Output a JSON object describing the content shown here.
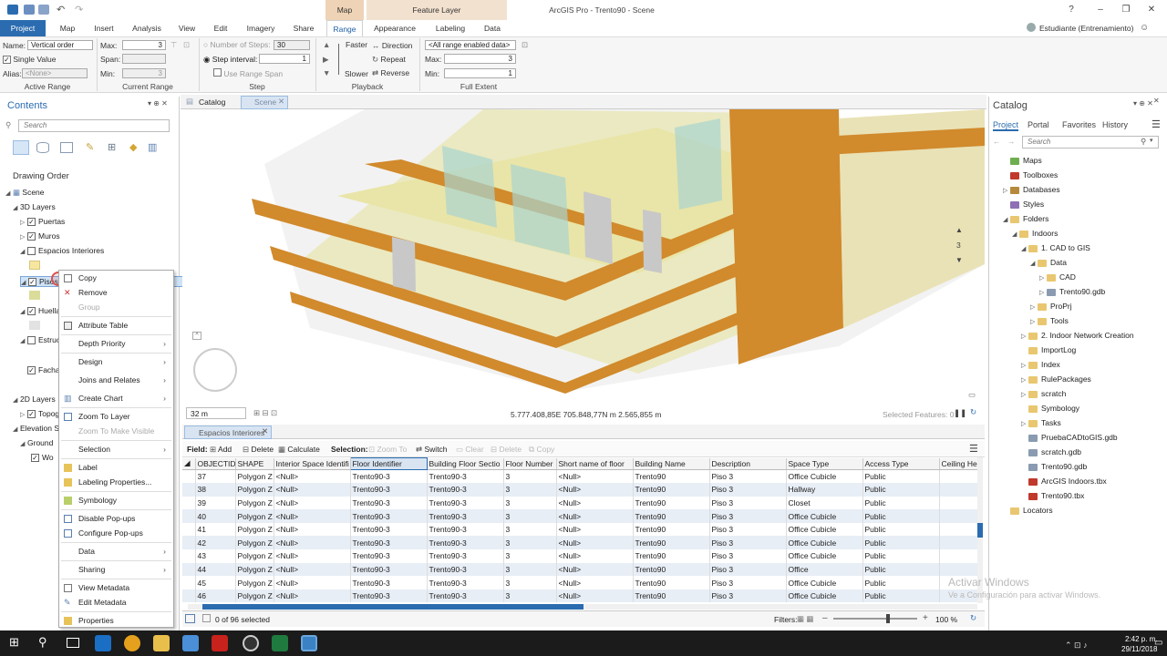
{
  "window": {
    "title": "ArcGIS Pro - Trento90 - Scene",
    "context_map": "Map",
    "context_feature_layer": "Feature Layer",
    "user": "Estudiante (Entrenamiento)",
    "help": "?"
  },
  "ribbon_tabs": [
    "Project",
    "Map",
    "Insert",
    "Analysis",
    "View",
    "Edit",
    "Imagery",
    "Share",
    "Range",
    "Appearance",
    "Labeling",
    "Data"
  ],
  "ribbon": {
    "name_label": "Name:",
    "name_value": "Vertical order",
    "single_value": "Single Value",
    "alias_label": "Alias:",
    "alias_value": "<None>",
    "max_label": "Max:",
    "max_value": "3",
    "span_label": "Span:",
    "min_label": "Min:",
    "min_value": "3",
    "num_steps": "Number of Steps:",
    "num_steps_value": "30",
    "step_interval": "Step interval:",
    "step_interval_value": "1",
    "use_range_span": "Use Range Span",
    "faster": "Faster",
    "slower": "Slower",
    "direction": "Direction",
    "repeat": "Repeat",
    "reverse": "Reverse",
    "extent_select": "<All range enabled data>",
    "ext_max_label": "Max:",
    "ext_max_value": "3",
    "ext_min_label": "Min:",
    "ext_min_value": "1",
    "groups": [
      "Active Range",
      "Current Range",
      "Step",
      "Playback",
      "Full Extent"
    ]
  },
  "contents": {
    "title": "Contents",
    "search_placeholder": "Search",
    "drawing_order": "Drawing Order",
    "tree": [
      "Scene",
      "3D Layers",
      "Puertas",
      "Muros",
      "Espacios Interiores",
      "Pisos",
      "Huella",
      "Estruct",
      "Fachas",
      "2D Layers",
      "Topog",
      "Elevation Su",
      "Ground",
      "Wo"
    ]
  },
  "context_menu": [
    "Copy",
    "Remove",
    "Group",
    "Attribute Table",
    "Depth Priority",
    "Design",
    "Joins and Relates",
    "Create Chart",
    "Zoom To Layer",
    "Zoom To Make Visible",
    "Selection",
    "Label",
    "Labeling Properties...",
    "Symbology",
    "Disable Pop-ups",
    "Configure Pop-ups",
    "Data",
    "Sharing",
    "View Metadata",
    "Edit Metadata",
    "Properties"
  ],
  "view_tabs": [
    "Catalog",
    "Scene"
  ],
  "scene": {
    "scale": "32 m",
    "coords": "5.777.408,85E 705.848,77N m   2.565,855 m",
    "selected_features": "Selected Features: 0",
    "range_value": "3"
  },
  "table": {
    "tab": "Espacios Interiores",
    "field_label": "Field:",
    "add": "Add",
    "delete": "Delete",
    "calculate": "Calculate",
    "selection_label": "Selection:",
    "zoom_to": "Zoom To",
    "switch": "Switch",
    "clear": "Clear",
    "sel_delete": "Delete",
    "copy": "Copy",
    "columns": [
      "OBJECTID",
      "SHAPE",
      "Interior Space Identifi",
      "Floor Identifier",
      "Building Floor Sectio",
      "Floor Number",
      "Short name of floor",
      "Building Name",
      "Description",
      "Space Type",
      "Access Type",
      "Ceiling He"
    ],
    "rows": [
      [
        "37",
        "Polygon Z",
        "<Null>",
        "Trento90-3",
        "Trento90-3",
        "3",
        "<Null>",
        "Trento90",
        "Piso 3",
        "Office Cubicle",
        "Public",
        ""
      ],
      [
        "38",
        "Polygon Z",
        "<Null>",
        "Trento90-3",
        "Trento90-3",
        "3",
        "<Null>",
        "Trento90",
        "Piso 3",
        "Hallway",
        "Public",
        ""
      ],
      [
        "39",
        "Polygon Z",
        "<Null>",
        "Trento90-3",
        "Trento90-3",
        "3",
        "<Null>",
        "Trento90",
        "Piso 3",
        "Closet",
        "Public",
        ""
      ],
      [
        "40",
        "Polygon Z",
        "<Null>",
        "Trento90-3",
        "Trento90-3",
        "3",
        "<Null>",
        "Trento90",
        "Piso 3",
        "Office Cubicle",
        "Public",
        ""
      ],
      [
        "41",
        "Polygon Z",
        "<Null>",
        "Trento90-3",
        "Trento90-3",
        "3",
        "<Null>",
        "Trento90",
        "Piso 3",
        "Office Cubicle",
        "Public",
        ""
      ],
      [
        "42",
        "Polygon Z",
        "<Null>",
        "Trento90-3",
        "Trento90-3",
        "3",
        "<Null>",
        "Trento90",
        "Piso 3",
        "Office Cubicle",
        "Public",
        ""
      ],
      [
        "43",
        "Polygon Z",
        "<Null>",
        "Trento90-3",
        "Trento90-3",
        "3",
        "<Null>",
        "Trento90",
        "Piso 3",
        "Office Cubicle",
        "Public",
        ""
      ],
      [
        "44",
        "Polygon Z",
        "<Null>",
        "Trento90-3",
        "Trento90-3",
        "3",
        "<Null>",
        "Trento90",
        "Piso 3",
        "Office",
        "Public",
        ""
      ],
      [
        "45",
        "Polygon Z",
        "<Null>",
        "Trento90-3",
        "Trento90-3",
        "3",
        "<Null>",
        "Trento90",
        "Piso 3",
        "Office Cubicle",
        "Public",
        ""
      ],
      [
        "46",
        "Polygon Z",
        "<Null>",
        "Trento90-3",
        "Trento90-3",
        "3",
        "<Null>",
        "Trento90",
        "Piso 3",
        "Office Cubicle",
        "Public",
        ""
      ]
    ],
    "footer_selected": "0 of 96 selected",
    "filters": "Filters:",
    "zoom": "100 %"
  },
  "catalog": {
    "title": "Catalog",
    "tabs": [
      "Project",
      "Portal",
      "Favorites",
      "History"
    ],
    "search_placeholder": "Search",
    "tree": [
      "Maps",
      "Toolboxes",
      "Databases",
      "Styles",
      "Folders",
      "Indoors",
      "1. CAD to GIS",
      "Data",
      "CAD",
      "Trento90.gdb",
      "ProPrj",
      "Tools",
      "2. Indoor Network Creation",
      "ImportLog",
      "Index",
      "RulePackages",
      "scratch",
      "Symbology",
      "Tasks",
      "PruebaCADtoGIS.gdb",
      "scratch.gdb",
      "Trento90.gdb",
      "ArcGIS Indoors.tbx",
      "Trento90.tbx",
      "Locators"
    ]
  },
  "watermark": {
    "line1": "Activar Windows",
    "line2": "Ve a Configuración para activar Windows."
  },
  "taskbar": {
    "time": "2:42 p. m.",
    "date": "29/11/2018"
  },
  "colors": {
    "accent": "#2b6cb0",
    "wall": "#d18a2c",
    "floor": "#e9e5a8",
    "glass": "#a9d4cf"
  }
}
